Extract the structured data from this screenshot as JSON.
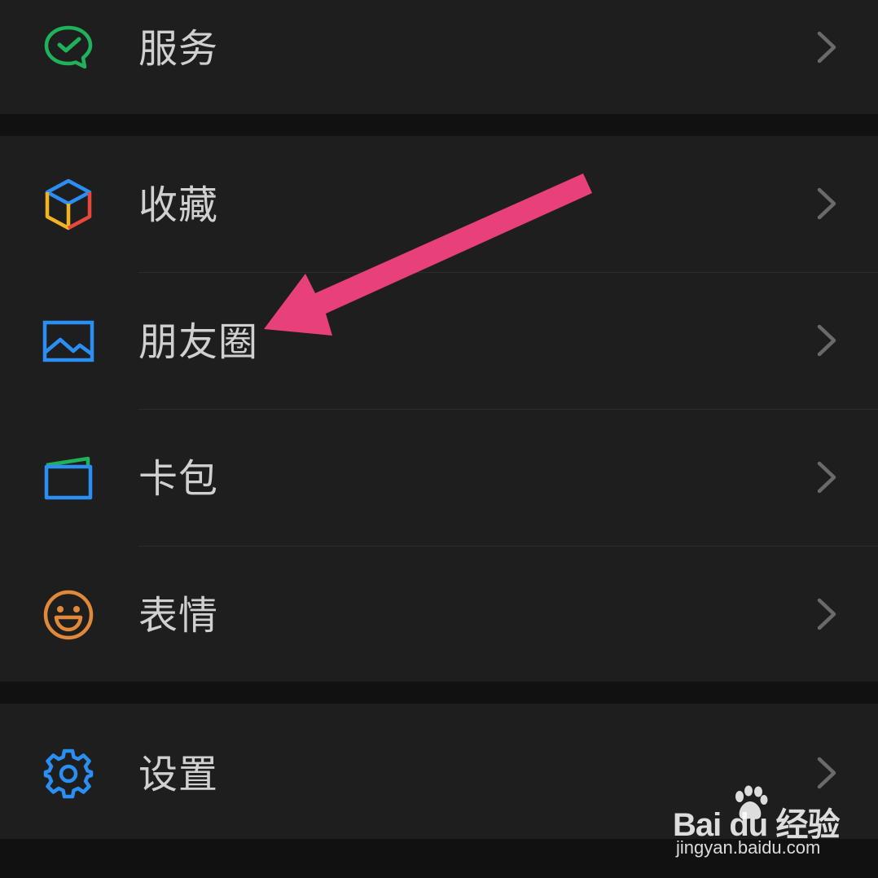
{
  "menu": {
    "group1": [
      {
        "id": "services",
        "label": "服务",
        "icon": "wechat-pay-icon"
      }
    ],
    "group2": [
      {
        "id": "favorites",
        "label": "收藏",
        "icon": "cube-icon"
      },
      {
        "id": "moments",
        "label": "朋友圈",
        "icon": "image-icon"
      },
      {
        "id": "cards",
        "label": "卡包",
        "icon": "wallet-icon"
      },
      {
        "id": "stickers",
        "label": "表情",
        "icon": "smiley-icon"
      }
    ],
    "group3": [
      {
        "id": "settings",
        "label": "设置",
        "icon": "gear-icon"
      }
    ]
  },
  "colors": {
    "background": "#111111",
    "row_background": "#1e1e1e",
    "label": "#d0d0d0",
    "chevron": "#6a6a6a",
    "annotation_arrow": "#e8407a"
  },
  "watermark": {
    "brand": "Bai du 经验",
    "sub": "jingyan.baidu.com"
  }
}
